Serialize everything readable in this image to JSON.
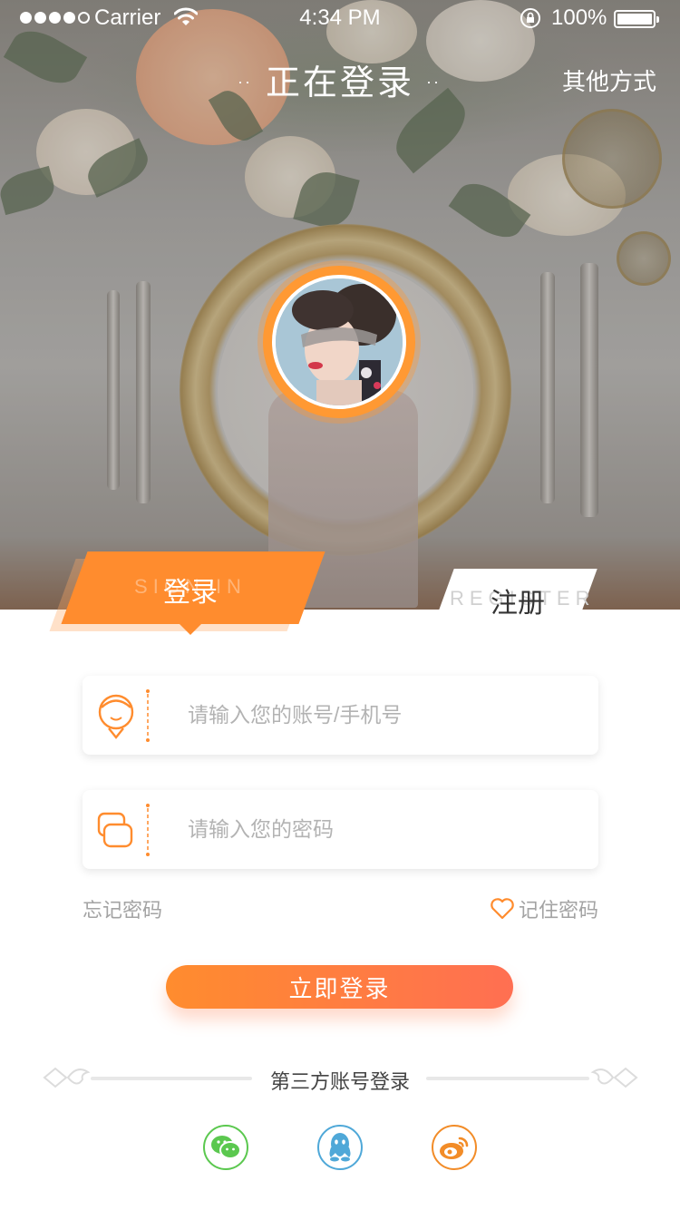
{
  "status_bar": {
    "carrier": "Carrier",
    "time": "4:34 PM",
    "battery": "100%"
  },
  "nav": {
    "title": "正在登录",
    "title_dots_left": "··",
    "title_dots_right": "··",
    "other_methods": "其他方式"
  },
  "tabs": {
    "login": {
      "label": "登录",
      "en": "SIGN IN"
    },
    "register": {
      "label": "注册",
      "en": "REGISTER"
    }
  },
  "form": {
    "account_placeholder": "请输入您的账号/手机号",
    "password_placeholder": "请输入您的密码",
    "forgot_password": "忘记密码",
    "remember_password": "记住密码",
    "submit": "立即登录"
  },
  "third_party": {
    "title": "第三方账号登录",
    "providers": [
      "wechat",
      "qq",
      "weibo"
    ]
  },
  "colors": {
    "accent": "#ff8c2e",
    "accent_end": "#ff6f52",
    "wechat": "#5bc84f",
    "qq": "#4fa8d8",
    "weibo": "#f28c28"
  },
  "icons": [
    "signal-icon",
    "wifi-icon",
    "lock-icon",
    "battery-icon",
    "user-icon",
    "password-icon",
    "heart-icon",
    "wechat-icon",
    "qq-icon",
    "weibo-icon"
  ]
}
